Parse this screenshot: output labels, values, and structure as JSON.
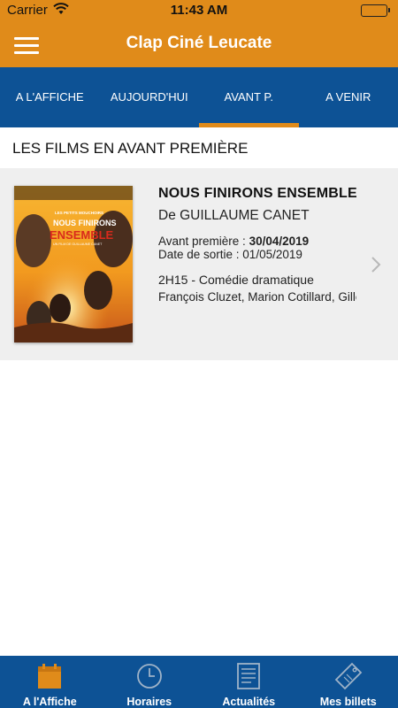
{
  "status_bar": {
    "carrier": "Carrier",
    "time": "11:43 AM"
  },
  "header": {
    "title": "Clap Ciné Leucate"
  },
  "top_tabs": [
    {
      "label": "A L'AFFICHE"
    },
    {
      "label": "AUJOURD'HUI"
    },
    {
      "label": "AVANT P.",
      "active": true
    },
    {
      "label": "A VENIR"
    }
  ],
  "section": {
    "title": "LES FILMS EN AVANT PREMIÈRE"
  },
  "film": {
    "title": "NOUS FINIRONS ENSEMBLE",
    "director": "De GUILLAUME CANET",
    "premiere_label": "Avant première : ",
    "premiere_date": "30/04/2019",
    "release": "Date de sortie : 01/05/2019",
    "duration_genre": "2H15 - Comédie dramatique",
    "cast": "François Cluzet, Marion Cotillard, Gilles Lellouche",
    "poster": {
      "small_title": "LES PETITS MOUCHOIRS",
      "title_line1": "NOUS FINIRONS",
      "title_line2": "ENSEMBLE",
      "byline": "UN FILM DE GUILLAUME CANET"
    }
  },
  "bottom_tabs": [
    {
      "label": "A l'Affiche",
      "icon": "calendar-icon",
      "active": true
    },
    {
      "label": "Horaires",
      "icon": "clock-icon"
    },
    {
      "label": "Actualités",
      "icon": "newspaper-icon"
    },
    {
      "label": "Mes billets",
      "icon": "ticket-icon"
    }
  ],
  "colors": {
    "accent": "#e08b1a",
    "brand_blue": "#0d5295",
    "card_bg": "#efefef"
  }
}
